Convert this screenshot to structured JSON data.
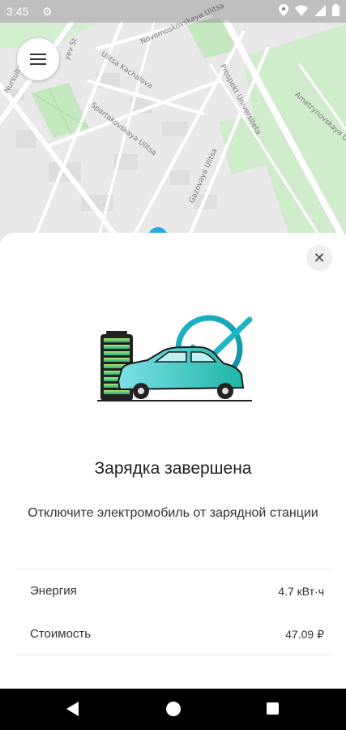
{
  "status_bar": {
    "time": "3:45"
  },
  "map": {
    "streets": [
      "Nursultan",
      "Ulitsa Kachalova",
      "Spartakovskaya Ulitsa",
      "Gazovaya Ulitsa",
      "Prospekt Universiteta",
      "Novomoskovskaya Ulitsa",
      "Ametrynovskaya Ulitsa",
      "yev St"
    ]
  },
  "sheet": {
    "title": "Зарядка завершена",
    "subtitle": "Отключите электромобиль от зарядной станции",
    "rows": [
      {
        "label": "Энергия",
        "value": "4.7 кВт·ч"
      },
      {
        "label": "Стоимость",
        "value": "47.09 ₽"
      }
    ]
  },
  "colors": {
    "accent": "#1fb5c6",
    "park_green": "#bfe6b8",
    "nav_bg": "#000000"
  }
}
